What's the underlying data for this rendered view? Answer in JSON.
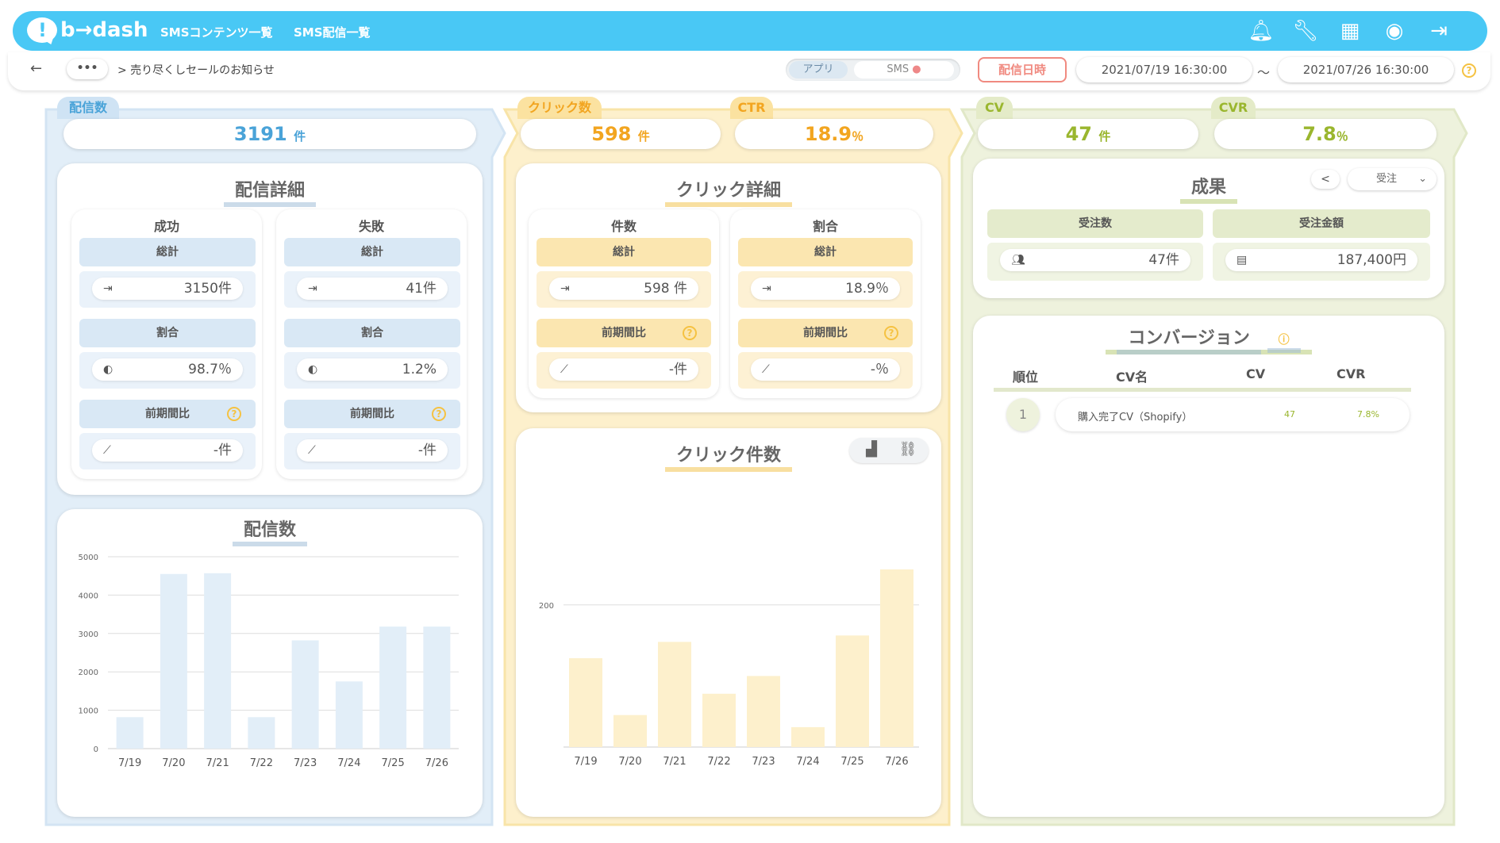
{
  "brand": "b→dash",
  "nav": {
    "contents": "SMSコンテンツ一覧",
    "delivery": "SMS配信一覧"
  },
  "breadcrumb": {
    "more": "•••",
    "path": "> 売り尽くしセールのお知らせ"
  },
  "toggle": {
    "app": "アプリ",
    "sms": "SMS"
  },
  "date_label": "配信日時",
  "date_from": "2021/07/19 16:30:00",
  "date_sep": "〜",
  "date_to": "2021/07/26 16:30:00",
  "delivery": {
    "tab": "配信数",
    "total": "3191",
    "unit": "件",
    "detail_title": "配信詳細",
    "success": {
      "head": "成功",
      "total_label": "総計",
      "total": "3150件",
      "ratio_label": "割合",
      "ratio": "98.7％",
      "prev_label": "前期間比",
      "prev": "-件"
    },
    "fail": {
      "head": "失敗",
      "total_label": "総計",
      "total": "41件",
      "ratio_label": "割合",
      "ratio": "1.2%",
      "prev_label": "前期間比",
      "prev": "-件"
    },
    "chart_title": "配信数"
  },
  "click": {
    "tab": "クリック数",
    "total": "598",
    "unit": "件",
    "ctr_tab": "CTR",
    "ctr": "18.9",
    "ctr_unit": "％",
    "detail_title": "クリック詳細",
    "count": {
      "head": "件数",
      "total_label": "総計",
      "total": "598 件",
      "prev_label": "前期間比",
      "prev": "-件"
    },
    "ratio": {
      "head": "割合",
      "total_label": "総計",
      "total": "18.9％",
      "prev_label": "前期間比",
      "prev": "-％"
    },
    "chart_title": "クリック件数"
  },
  "cv": {
    "tab": "CV",
    "total": "47",
    "unit": "件",
    "cvr_tab": "CVR",
    "cvr": "7.8",
    "cvr_unit": "％",
    "result_title": "成果",
    "select": "受注",
    "orders_label": "受注数",
    "orders": "47件",
    "amount_label": "受注金額",
    "amount": "187,400円",
    "conv_title": "コンバージョン",
    "table_headers": [
      "順位",
      "CV名",
      "CV",
      "CVR"
    ],
    "rows": [
      {
        "rank": "1",
        "name": "購入完了CV（Shopify）",
        "cv": "47",
        "cvr": "7.8%"
      }
    ]
  },
  "colors": {
    "blue": "#49c8f5",
    "deliv": "#e2eef8",
    "click": "#fdf0cc",
    "cv": "#eef2dd",
    "ctr_text": "#f2a520",
    "cv_text": "#9ab62e",
    "deliv_text": "#4aa3d8"
  },
  "chart_data": [
    {
      "type": "bar",
      "title": "配信数",
      "categories": [
        "7/19",
        "7/20",
        "7/21",
        "7/22",
        "7/23",
        "7/24",
        "7/25",
        "7/26"
      ],
      "values": [
        820,
        4550,
        4570,
        820,
        2820,
        1750,
        3180,
        3180
      ],
      "ylim": [
        0,
        5000
      ],
      "yticks": [
        "0",
        "1000",
        "2000",
        "3000",
        "4000",
        "5000"
      ],
      "grid": true
    },
    {
      "type": "bar",
      "title": "クリック件数",
      "categories": [
        "7/19",
        "7/20",
        "7/21",
        "7/22",
        "7/23",
        "7/24",
        "7/25",
        "7/26"
      ],
      "values": [
        125,
        45,
        148,
        75,
        100,
        28,
        157,
        250
      ],
      "ylim": [
        0,
        250
      ],
      "yticks": [
        "200"
      ],
      "grid": true
    }
  ]
}
